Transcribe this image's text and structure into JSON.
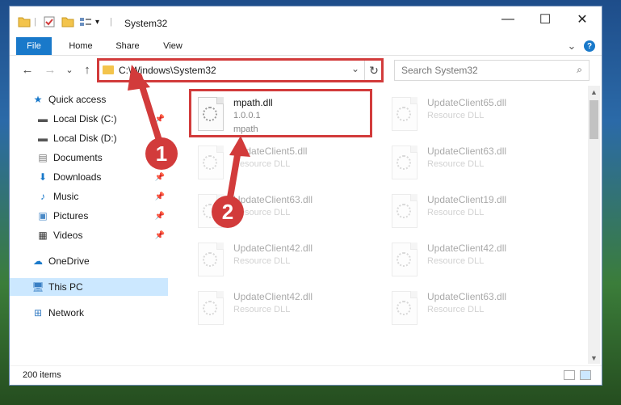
{
  "window": {
    "title": "System32",
    "controls": {
      "minimize": "—",
      "maximize": "☐",
      "close": "✕"
    },
    "quick_access_toolbar": {
      "separator": "|",
      "dropdown": "▾"
    }
  },
  "ribbon": {
    "tabs": [
      {
        "label": "File"
      },
      {
        "label": "Home"
      },
      {
        "label": "Share"
      },
      {
        "label": "View"
      }
    ],
    "expand_icon": "⌄",
    "help_icon": "?"
  },
  "navigation": {
    "back": "←",
    "forward": "→",
    "recent": "⌄",
    "up": "↑",
    "address": "C:\\Windows\\System32",
    "address_dropdown": "⌄",
    "refresh": "↻",
    "search_placeholder": "Search System32",
    "search_icon": "⌕"
  },
  "sidebar": {
    "items": [
      {
        "label": "Quick access",
        "icon": "star-icon",
        "glyph": "★",
        "color": "#1979ca",
        "pinned": ""
      },
      {
        "label": "Local Disk (C:)",
        "icon": "drive-icon",
        "glyph": "▬",
        "color": "#555555",
        "pinned": "📌"
      },
      {
        "label": "Local Disk (D:)",
        "icon": "drive-icon",
        "glyph": "▬",
        "color": "#555555",
        "pinned": ""
      },
      {
        "label": "Documents",
        "icon": "documents-icon",
        "glyph": "▤",
        "color": "#777777",
        "pinned": "📌"
      },
      {
        "label": "Downloads",
        "icon": "download-icon",
        "glyph": "⬇",
        "color": "#1979ca",
        "pinned": "📌"
      },
      {
        "label": "Music",
        "icon": "music-icon",
        "glyph": "♪",
        "color": "#1979ca",
        "pinned": "📌"
      },
      {
        "label": "Pictures",
        "icon": "pictures-icon",
        "glyph": "▣",
        "color": "#4a8ac7",
        "pinned": "📌"
      },
      {
        "label": "Videos",
        "icon": "videos-icon",
        "glyph": "▦",
        "color": "#333333",
        "pinned": "📌"
      },
      {
        "label": "OneDrive",
        "icon": "cloud-icon",
        "glyph": "☁",
        "color": "#1979ca",
        "pinned": ""
      },
      {
        "label": "This PC",
        "icon": "computer-icon",
        "glyph": "🖥",
        "color": "#3a7fc4",
        "pinned": ""
      },
      {
        "label": "Network",
        "icon": "network-icon",
        "glyph": "⊞",
        "color": "#3a7fc4",
        "pinned": ""
      }
    ]
  },
  "files": [
    {
      "name": "mpath.dll",
      "line1": "1.0.0.1",
      "line2": "mpath",
      "highlighted": true
    },
    {
      "name": "UpdateClient65.dll",
      "line1": "Resource DLL",
      "line2": ""
    },
    {
      "name": "UpdateClient5.dll",
      "line1": "Resource DLL",
      "line2": ""
    },
    {
      "name": "UpdateClient63.dll",
      "line1": "Resource DLL",
      "line2": ""
    },
    {
      "name": "UpdateClient63.dll",
      "line1": "Resource DLL",
      "line2": ""
    },
    {
      "name": "UpdateClient19.dll",
      "line1": "Resource DLL",
      "line2": ""
    },
    {
      "name": "UpdateClient42.dll",
      "line1": "Resource DLL",
      "line2": ""
    },
    {
      "name": "UpdateClient42.dll",
      "line1": "Resource DLL",
      "line2": ""
    },
    {
      "name": "UpdateClient42.dll",
      "line1": "Resource DLL",
      "line2": ""
    },
    {
      "name": "UpdateClient63.dll",
      "line1": "Resource DLL",
      "line2": ""
    }
  ],
  "status": {
    "count": "200 items"
  },
  "annotations": {
    "callout_1": "1",
    "callout_2": "2",
    "highlight_color": "#d23b3b"
  },
  "scrollbar": {
    "up": "▲",
    "down": "▼"
  }
}
